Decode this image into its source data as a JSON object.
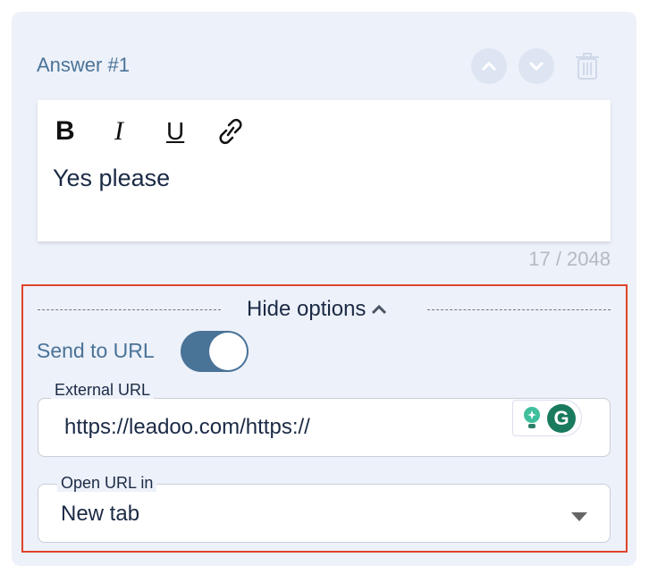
{
  "answer": {
    "title": "Answer #1",
    "icons": {
      "up": "chevron-up-icon",
      "down": "chevron-down-icon",
      "delete": "trash-icon"
    }
  },
  "editor": {
    "toolbar": {
      "bold": "B",
      "italic": "I",
      "underline": "U",
      "link": "link-icon"
    },
    "content": "Yes please",
    "counter": "17 / 2048"
  },
  "options": {
    "toggle_label": "Hide options",
    "send_to_url": {
      "label": "Send to URL",
      "enabled": true
    },
    "external_url": {
      "label": "External URL",
      "value": "https://leadoo.com/https://"
    },
    "open_url_in": {
      "label": "Open URL in",
      "value": "New tab"
    }
  },
  "colors": {
    "accent": "#4a7398",
    "highlight": "#e0432b",
    "panel": "#edf1f9"
  }
}
